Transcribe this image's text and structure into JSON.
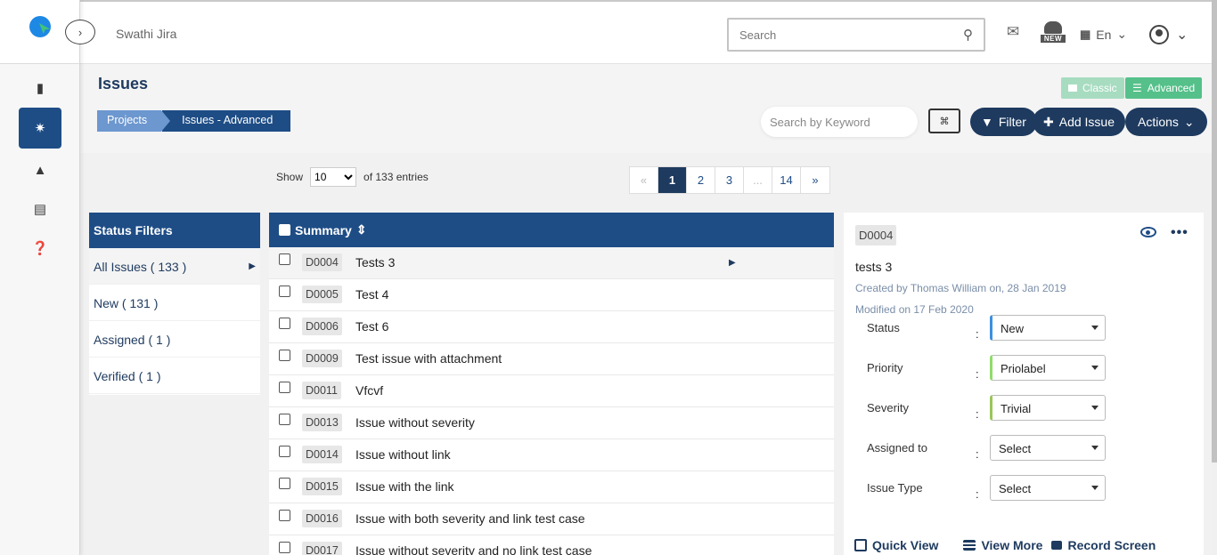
{
  "app": {
    "project_name": "Swathi Jira",
    "search_placeholder": "Search",
    "new_badge": "NEW",
    "language": "En"
  },
  "rail": {
    "items": [
      "clipboard-icon",
      "bug-icon",
      "lighthouse-icon",
      "card-icon",
      "help-icon"
    ],
    "active": "bug-icon"
  },
  "header": {
    "title": "Issues",
    "breadcrumb": [
      "Projects",
      "Issues - Advanced"
    ],
    "mode_classic": "Classic",
    "mode_advanced": "Advanced",
    "keyword_placeholder": "Search by Keyword",
    "filter_label": "Filter",
    "add_issue_label": "Add Issue",
    "actions_label": "Actions"
  },
  "entries": {
    "show_label": "Show",
    "page_size": "10",
    "total_label": "of 133 entries"
  },
  "pagination": {
    "prev": "«",
    "pages": [
      "1",
      "2",
      "3",
      "...",
      "14"
    ],
    "next": "»",
    "current": "1"
  },
  "status_filters": {
    "title": "Status Filters",
    "items": [
      "All Issues ( 133 )",
      "New ( 131 )",
      "Assigned ( 1 )",
      "Verified ( 1 )"
    ]
  },
  "table": {
    "header": "Summary",
    "rows": [
      {
        "key": "D0004",
        "summary": "Tests 3"
      },
      {
        "key": "D0005",
        "summary": "Test 4"
      },
      {
        "key": "D0006",
        "summary": "Test 6"
      },
      {
        "key": "D0009",
        "summary": "Test issue with attachment"
      },
      {
        "key": "D0011",
        "summary": "Vfcvf"
      },
      {
        "key": "D0013",
        "summary": "Issue without severity"
      },
      {
        "key": "D0014",
        "summary": "Issue without link"
      },
      {
        "key": "D0015",
        "summary": "Issue with the link"
      },
      {
        "key": "D0016",
        "summary": "Issue with both severity and link test case"
      },
      {
        "key": "D0017",
        "summary": "Issue without severity and no link test case"
      }
    ]
  },
  "detail": {
    "key": "D0004",
    "title": "tests 3",
    "created": "Created by Thomas William on, 28 Jan 2019",
    "modified": "Modified on 17 Feb 2020",
    "fields": [
      {
        "label": "Status",
        "value": "New"
      },
      {
        "label": "Priority",
        "value": "Priolabel"
      },
      {
        "label": "Severity",
        "value": "Trivial"
      },
      {
        "label": "Assigned to",
        "value": "Select"
      },
      {
        "label": "Issue Type",
        "value": "Select"
      }
    ],
    "links": [
      "Quick View",
      "View More",
      "Record Screen"
    ]
  },
  "colors": {
    "primary": "#1e4d86",
    "navy": "#1e3a5f",
    "green": "#55c08a"
  }
}
